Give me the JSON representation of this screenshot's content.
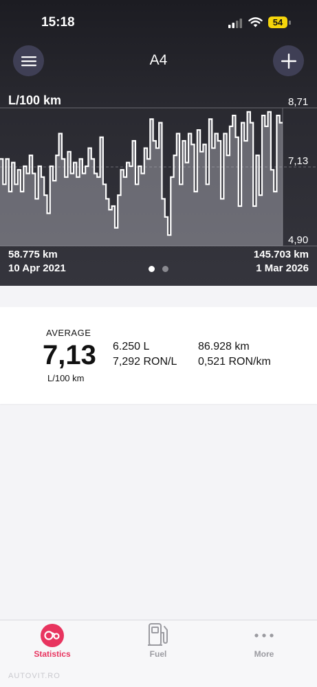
{
  "status_bar": {
    "time": "15:18",
    "battery": "54"
  },
  "header": {
    "title": "A4"
  },
  "chart": {
    "unit_label": "L/100 km",
    "y_max_label": "8,71",
    "y_mid_label": "7,13",
    "y_min_label": "4,90",
    "start_km": "58.775 km",
    "start_date": "10 Apr 2021",
    "end_km": "145.703 km",
    "end_date": "1 Mar 2026"
  },
  "chart_data": {
    "type": "area",
    "ylabel": "L/100 km",
    "ylim": [
      4.9,
      8.71
    ],
    "average": 7.13,
    "x_range": [
      "58.775 km",
      "145.703 km"
    ],
    "grid": true,
    "values": [
      7.3,
      6.6,
      7.3,
      6.4,
      7.2,
      6.6,
      7.0,
      6.4,
      7.1,
      6.9,
      7.4,
      6.9,
      6.2,
      7.1,
      6.8,
      6.3,
      5.8,
      7.1,
      6.7,
      7.4,
      8.0,
      7.3,
      6.8,
      7.5,
      6.9,
      7.2,
      6.8,
      7.3,
      6.9,
      7.1,
      7.6,
      7.3,
      6.9,
      6.8,
      7.9,
      6.6,
      6.2,
      5.9,
      6.0,
      5.4,
      6.3,
      7.0,
      6.8,
      7.2,
      7.1,
      7.8,
      6.6,
      7.1,
      6.9,
      7.6,
      7.3,
      8.4,
      7.8,
      7.6,
      8.3,
      6.2,
      5.7,
      5.2,
      6.8,
      7.4,
      8.0,
      6.6,
      7.8,
      7.2,
      8.0,
      7.7,
      6.4,
      8.1,
      7.5,
      7.7,
      6.6,
      8.4,
      7.6,
      8.0,
      7.8,
      6.2,
      8.0,
      7.4,
      8.2,
      8.5,
      7.9,
      6.0,
      8.3,
      7.8,
      8.6,
      8.3,
      6.0,
      7.4,
      6.3,
      8.5,
      8.2,
      8.6,
      7.0,
      6.4,
      8.5,
      8.3
    ]
  },
  "pager": {
    "pages": 2,
    "active": 0
  },
  "stats": {
    "average_label": "AVERAGE",
    "average_value": "7,13",
    "average_unit": "L/100 km",
    "liters": "6.250 L",
    "price_per_liter": "7,292 RON/L",
    "distance": "86.928 km",
    "cost_per_km": "0,521 RON/km"
  },
  "tabs": [
    {
      "label": "Statistics",
      "icon": "statistics-icon",
      "active": true
    },
    {
      "label": "Fuel",
      "icon": "fuel-pump-icon",
      "active": false
    },
    {
      "label": "More",
      "icon": "more-dots-icon",
      "active": false
    }
  ],
  "colors": {
    "accent": "#e8345f",
    "tab_inactive": "#9a9aa0",
    "header_bg": "#2a2a31"
  },
  "watermark": "AUTOVIT.RO"
}
